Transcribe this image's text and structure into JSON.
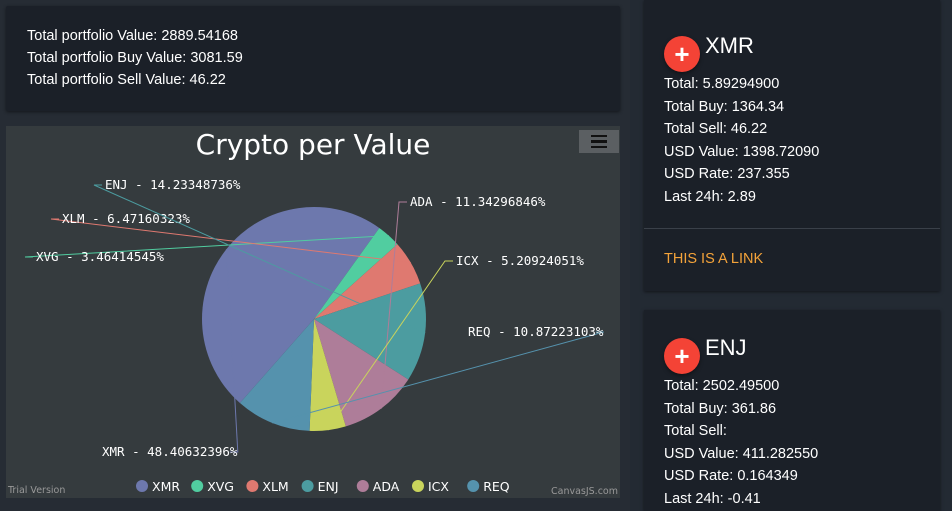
{
  "summary": {
    "total_value": "Total portfolio Value: 2889.54168",
    "total_buy": "Total portfolio Buy Value: 3081.59",
    "total_sell": "Total portfolio Sell Value: 46.22"
  },
  "chart_data": {
    "type": "pie",
    "title": "Crypto per Value",
    "categories": [
      "XMR",
      "XVG",
      "XLM",
      "ENJ",
      "ADA",
      "ICX",
      "REQ"
    ],
    "values": [
      48.40632396,
      3.46414545,
      6.47160323,
      14.23348736,
      11.34296846,
      5.20924051,
      10.87223103
    ],
    "labels": [
      "XMR - 48.40632396%",
      "XVG - 3.46414545%",
      "XLM - 6.47160323%",
      "ENJ - 14.23348736%",
      "ADA - 11.34296846%",
      "ICX - 5.20924051%",
      "REQ - 10.87223103%"
    ],
    "colors": [
      "#6d78ad",
      "#51cda0",
      "#df7970",
      "#4c9ca0",
      "#ae7d99",
      "#c9d45c",
      "#5592ad"
    ],
    "legend_position": "bottom",
    "trial_text": "Trial Version",
    "credit_text": "CanvasJS.com"
  },
  "coins": [
    {
      "name": "XMR",
      "total": "Total: 5.89294900",
      "total_buy": "Total Buy: 1364.34",
      "total_sell": "Total Sell: 46.22",
      "usd_value": "USD Value: 1398.72090",
      "usd_rate": "USD Rate: 237.355",
      "last_24h": "Last 24h: 2.89",
      "link": "THIS IS A LINK"
    },
    {
      "name": "ENJ",
      "total": "Total: 2502.49500",
      "total_buy": "Total Buy: 361.86",
      "total_sell": "Total Sell:",
      "usd_value": "USD Value: 411.282550",
      "usd_rate": "USD Rate: 0.164349",
      "last_24h": "Last 24h: -0.41"
    }
  ],
  "icons": {
    "add": "plus-icon",
    "menu": "hamburger-menu-icon"
  },
  "plus_glyph": "+"
}
